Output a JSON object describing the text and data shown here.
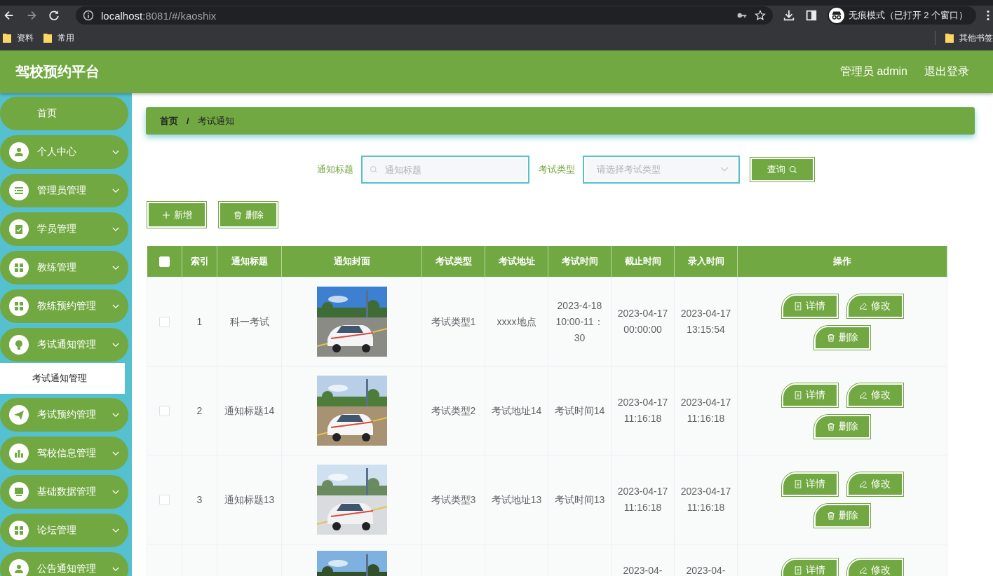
{
  "browser": {
    "url_host": "localhost",
    "url_path": ":8081/#/kaoshix",
    "profile": "无痕模式（已打开 2 个窗口）",
    "bookmarks": [
      "资料",
      "常用"
    ],
    "other_bookmarks": "其他书签"
  },
  "header": {
    "title": "驾校预约平台",
    "user": "管理员 admin",
    "logout": "退出登录"
  },
  "sidebar": {
    "items": [
      {
        "kind": "link",
        "label": "首页"
      },
      {
        "kind": "menu",
        "label": "个人中心"
      },
      {
        "kind": "menu",
        "label": "管理员管理"
      },
      {
        "kind": "menu",
        "label": "学员管理"
      },
      {
        "kind": "menu",
        "label": "教练管理"
      },
      {
        "kind": "menu",
        "label": "教练预约管理"
      },
      {
        "kind": "menu",
        "label": "考试通知管理",
        "children": [
          {
            "label": "考试通知管理",
            "selected": true
          }
        ]
      },
      {
        "kind": "menu",
        "label": "考试预约管理"
      },
      {
        "kind": "menu",
        "label": "驾校信息管理"
      },
      {
        "kind": "menu",
        "label": "基础数据管理"
      },
      {
        "kind": "menu",
        "label": "论坛管理"
      },
      {
        "kind": "menu",
        "label": "公告通知管理"
      }
    ]
  },
  "breadcrumb": {
    "items": [
      "首页",
      "考试通知"
    ],
    "separator": "/"
  },
  "search": {
    "fields": [
      {
        "kind": "input",
        "label": "通知标题",
        "placeholder": "通知标题"
      },
      {
        "kind": "select",
        "label": "考试类型",
        "placeholder": "请选择考试类型"
      }
    ],
    "button": "查询"
  },
  "toolbar": [
    {
      "kind": "add",
      "label": "新增"
    },
    {
      "kind": "delete",
      "label": "删除"
    }
  ],
  "table": {
    "select_all_checked": false,
    "columns": [
      "索引",
      "通知标题",
      "通知封面",
      "考试类型",
      "考试地址",
      "考试时间",
      "截止时间",
      "录入时间",
      "操作"
    ],
    "rows": [
      {
        "checked": false,
        "index": "1",
        "title": "科一考试",
        "cover": {
          "kind": "picture"
        },
        "type": "考试类型1",
        "address": "xxxx地点",
        "exam_time": "2023-4-18 10:00-11：30",
        "deadline": "2023-04-17 00:00:00",
        "entry_time": "2023-04-17 13:15:54",
        "actions": [
          {
            "kind": "detail",
            "label": "详情"
          },
          {
            "kind": "edit",
            "label": "修改"
          },
          {
            "kind": "delete",
            "label": "删除"
          }
        ]
      },
      {
        "checked": false,
        "index": "2",
        "title": "通知标题14",
        "cover": {
          "kind": "picture"
        },
        "type": "考试类型2",
        "address": "考试地址14",
        "exam_time": "考试时间14",
        "deadline": "2023-04-17 11:16:18",
        "entry_time": "2023-04-17 11:16:18",
        "actions": [
          {
            "kind": "detail",
            "label": "详情"
          },
          {
            "kind": "edit",
            "label": "修改"
          },
          {
            "kind": "delete",
            "label": "删除"
          }
        ]
      },
      {
        "checked": false,
        "index": "3",
        "title": "通知标题13",
        "cover": {
          "kind": "picture"
        },
        "type": "考试类型3",
        "address": "考试地址13",
        "exam_time": "考试时间13",
        "deadline": "2023-04-17 11:16:18",
        "entry_time": "2023-04-17 11:16:18",
        "actions": [
          {
            "kind": "detail",
            "label": "详情"
          },
          {
            "kind": "edit",
            "label": "修改"
          },
          {
            "kind": "delete",
            "label": "删除"
          }
        ]
      },
      {
        "cover": {
          "kind": "picture"
        },
        "deadline": "2023-04-",
        "entry_time": "2023-04-",
        "actions": [
          {
            "kind": "detail",
            "label": "详情"
          },
          {
            "kind": "edit",
            "label": "修改"
          }
        ]
      }
    ]
  }
}
